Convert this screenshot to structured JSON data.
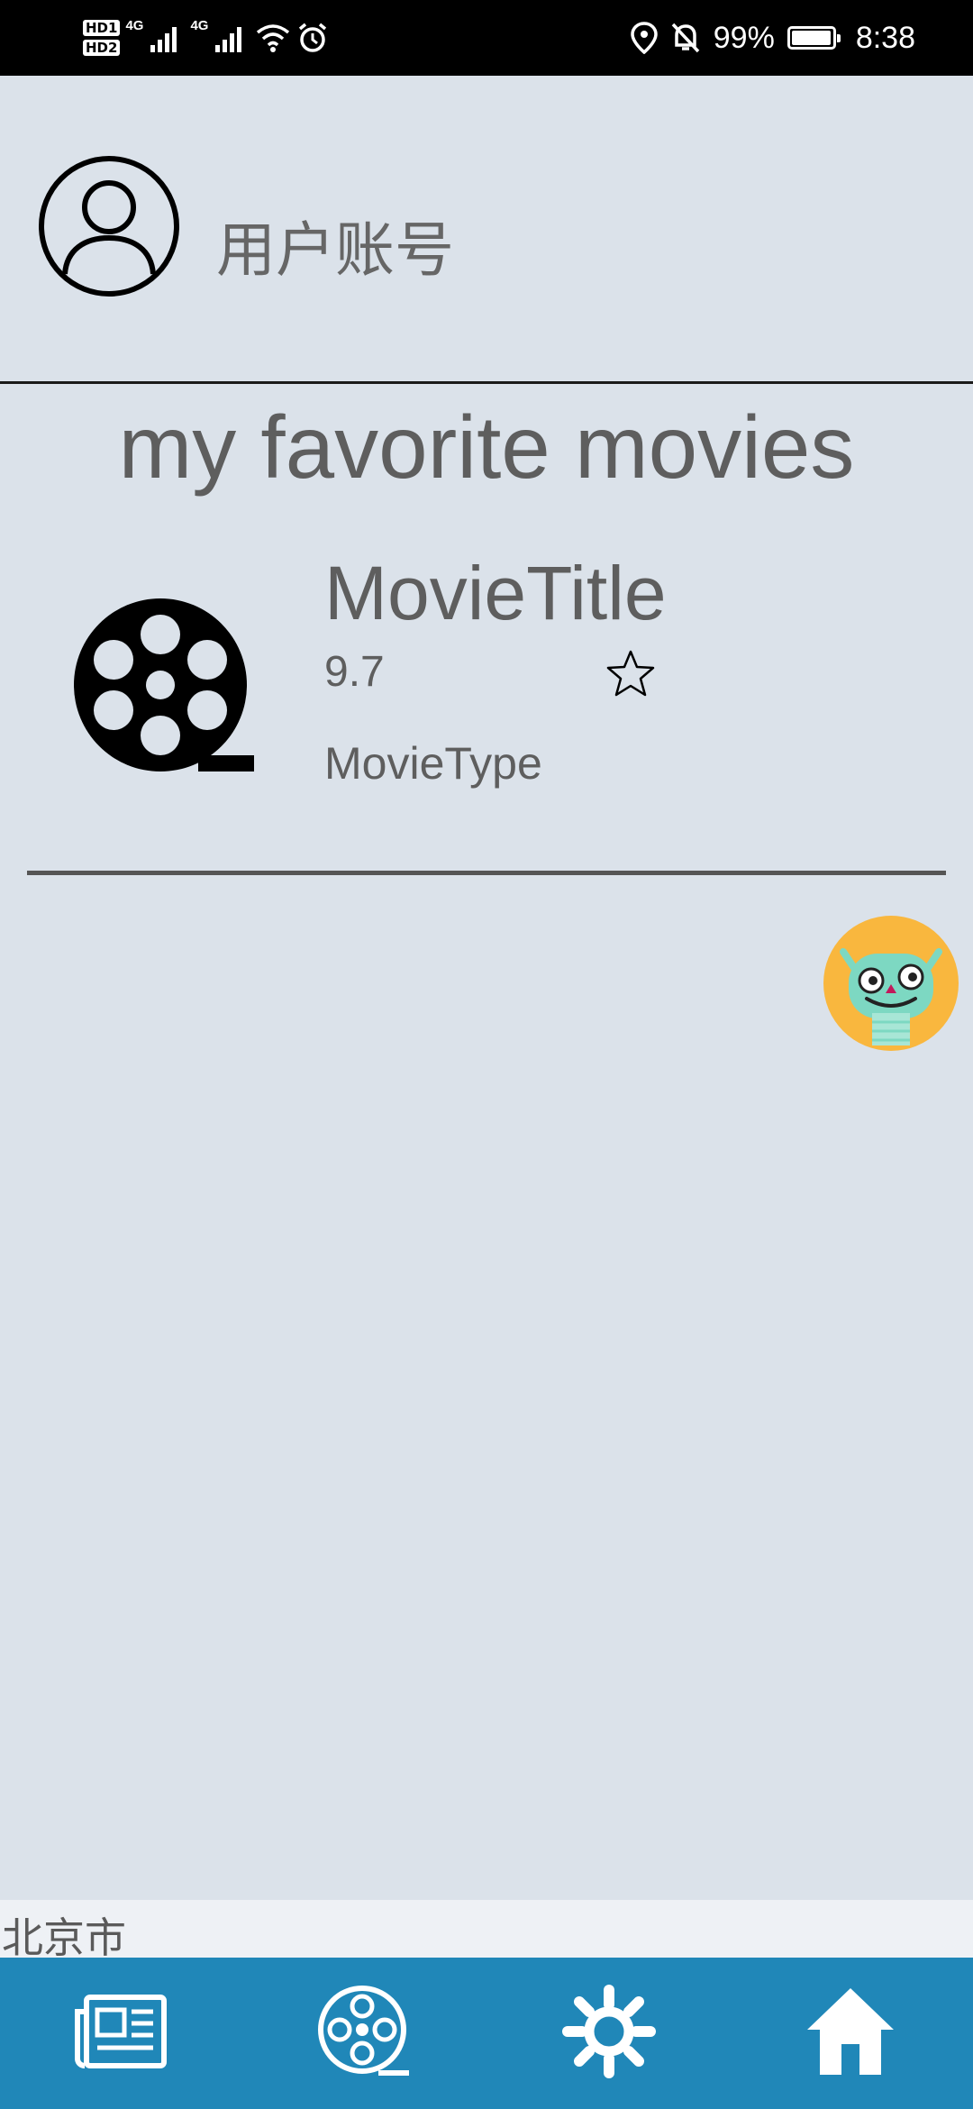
{
  "status_bar": {
    "hd1": "HD1",
    "hd2": "HD2",
    "net1": "4G",
    "net2": "4G",
    "battery": "99%",
    "battery_level": 0.99,
    "time": "8:38"
  },
  "account": {
    "label": "用户账号",
    "avatar_icon": "user-avatar-icon"
  },
  "favorites": {
    "title": "my favorite movies",
    "items": [
      {
        "title": "MovieTitle",
        "score": "9.7",
        "type": "MovieType",
        "icon": "film-reel-icon",
        "favorite_icon": "star-outline-icon"
      }
    ]
  },
  "floating_button": {
    "icon": "robot-mascot-icon"
  },
  "location": {
    "city": "北京市"
  },
  "tab_bar": {
    "tabs": [
      {
        "name": "news",
        "icon": "newspaper-icon"
      },
      {
        "name": "movies",
        "icon": "film-reel-icon"
      },
      {
        "name": "settings",
        "icon": "gear-icon"
      },
      {
        "name": "home",
        "icon": "home-icon"
      }
    ]
  },
  "colors": {
    "background": "#dbe2ea",
    "tab_bar": "#2087b8",
    "text": "#5e5e5e",
    "status_bar": "#000000"
  }
}
